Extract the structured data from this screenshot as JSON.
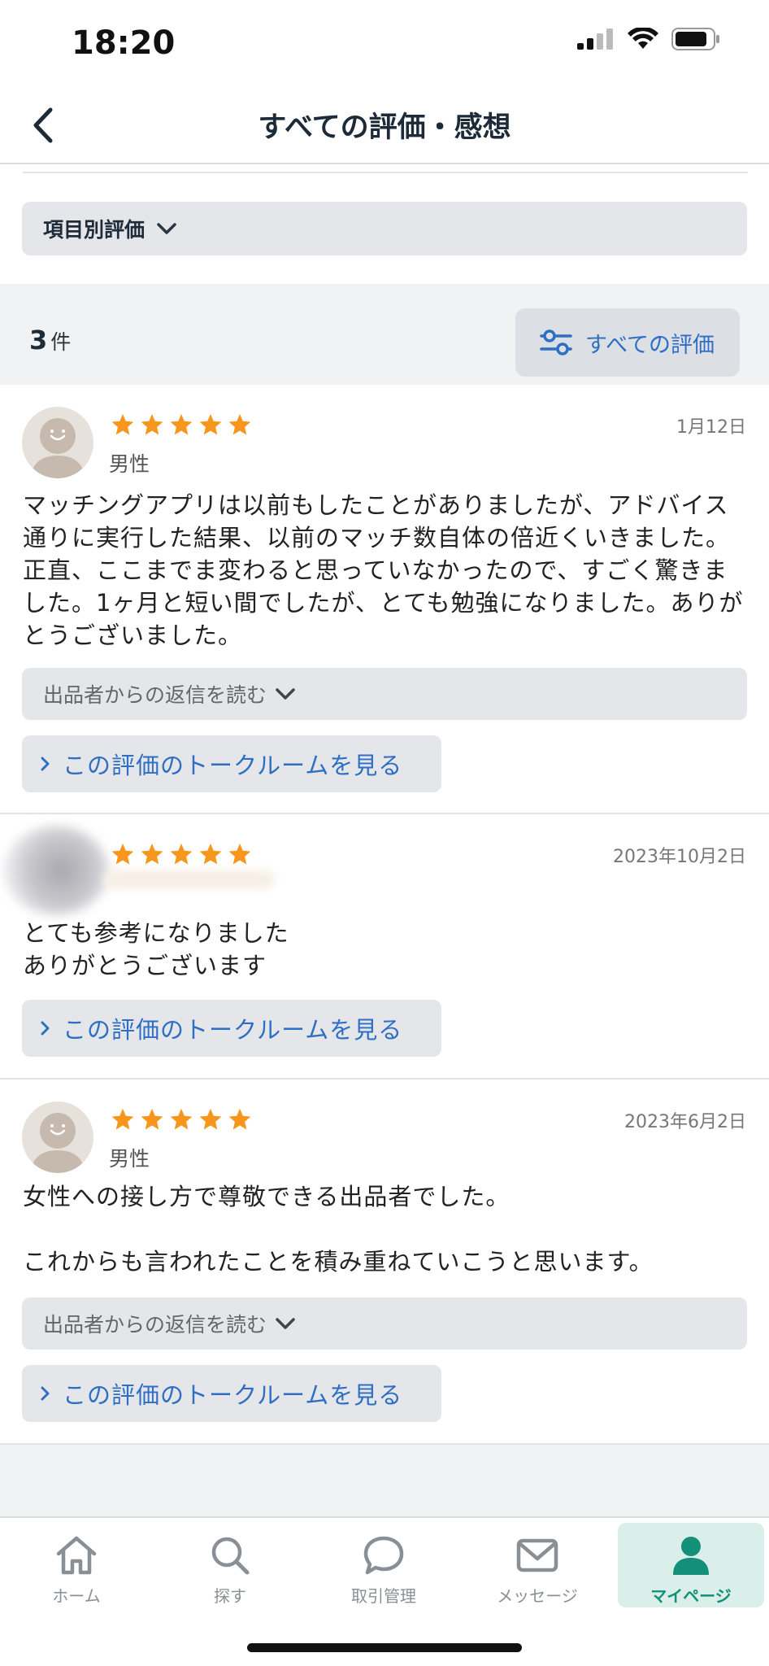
{
  "status_bar": {
    "time": "18:20"
  },
  "header": {
    "title": "すべての評価・感想"
  },
  "category_toggle": {
    "label": "項目別評価"
  },
  "summary": {
    "count": "3",
    "count_unit": "件",
    "filter_label": "すべての評価"
  },
  "colors": {
    "accent_blue": "#2e6fc4",
    "star_orange": "#f7961c",
    "active_green": "#149079"
  },
  "reviews": [
    {
      "rating": 5,
      "gender": "男性",
      "date": "1月12日",
      "body": "マッチングアプリは以前もしたことがありましたが、アドバイス通りに実行した結果、以前のマッチ数自体の倍近くいきました。正直、ここまでま変わると思っていなかったので、すごく驚きました。1ヶ月と短い間でしたが、とても勉強になりました。ありがとうございました。",
      "reply_label": "出品者からの返信を読む",
      "talk_label": "この評価のトークルームを見る"
    },
    {
      "rating": 5,
      "gender": "",
      "date": "2023年10月2日",
      "body": "とても参考になりました\nありがとうございます",
      "talk_label": "この評価のトークルームを見る"
    },
    {
      "rating": 5,
      "gender": "男性",
      "date": "2023年6月2日",
      "body": "女性への接し方で尊敬できる出品者でした。\n\nこれからも言われたことを積み重ねていこうと思います。",
      "reply_label": "出品者からの返信を読む",
      "talk_label": "この評価のトークルームを見る"
    }
  ],
  "tabs": [
    {
      "label": "ホーム",
      "icon": "home-icon"
    },
    {
      "label": "探す",
      "icon": "search-icon"
    },
    {
      "label": "取引管理",
      "icon": "chat-bubble-icon"
    },
    {
      "label": "メッセージ",
      "icon": "mail-icon"
    },
    {
      "label": "マイページ",
      "icon": "person-icon",
      "active": true
    }
  ]
}
